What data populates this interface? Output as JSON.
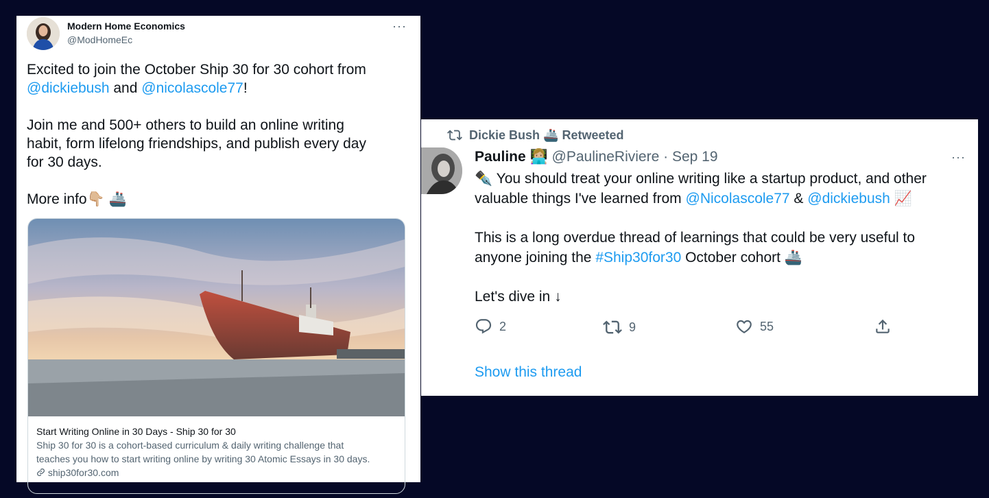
{
  "tweet1": {
    "author_name": "Modern Home Economics",
    "author_handle": "@ModHomeEc",
    "more_label": "···",
    "line1_a": "Excited to join the October Ship 30 for 30 cohort from",
    "mention1": "@dickiebush",
    "line2_and": " and ",
    "mention2": "@nicolascole77",
    "line2_end": "!",
    "para2_line1": "Join me and 500+ others to build an online writing",
    "para2_line2": "habit, form lifelong friendships, and publish every day",
    "para2_line3": "for 30 days.",
    "more_info": "More info",
    "pointing_emoji": "👇🏼",
    "ship_emoji": "🚢",
    "card": {
      "title": "Start Writing Online in 30 Days - Ship 30 for 30",
      "desc_line1": "Ship 30 for 30 is a cohort-based curriculum & daily writing challenge that",
      "desc_line2": "teaches you how to start writing online by writing 30 Atomic Essays in 30 days.",
      "domain": "ship30for30.com"
    }
  },
  "tweet2": {
    "retweeter": "Dickie Bush",
    "retweeted_label": "Retweeted",
    "ship_emoji": "🚢",
    "author_name": "Pauline",
    "author_emoji": "👩🏼‍💻",
    "author_handle": "@PaulineRiviere",
    "dot": "·",
    "date": "Sep 19",
    "more_label": "···",
    "pen_emoji": "✒️",
    "line1": " You should treat your online writing like a startup product, and other",
    "line2_a": "valuable things I've learned from ",
    "mention1": "@Nicolascole77",
    "amp": " & ",
    "mention2": "@dickiebush",
    "chart_emoji": "📈",
    "para2_line1": "This is a long overdue thread of learnings that could be very useful to",
    "para2_line2_a": "anyone joining the ",
    "hashtag": "#Ship30for30",
    "para2_line2_b": " October cohort ",
    "para3": "Let's dive in ↓",
    "replies": "2",
    "retweets": "9",
    "likes": "55",
    "show_thread": "Show this thread"
  }
}
